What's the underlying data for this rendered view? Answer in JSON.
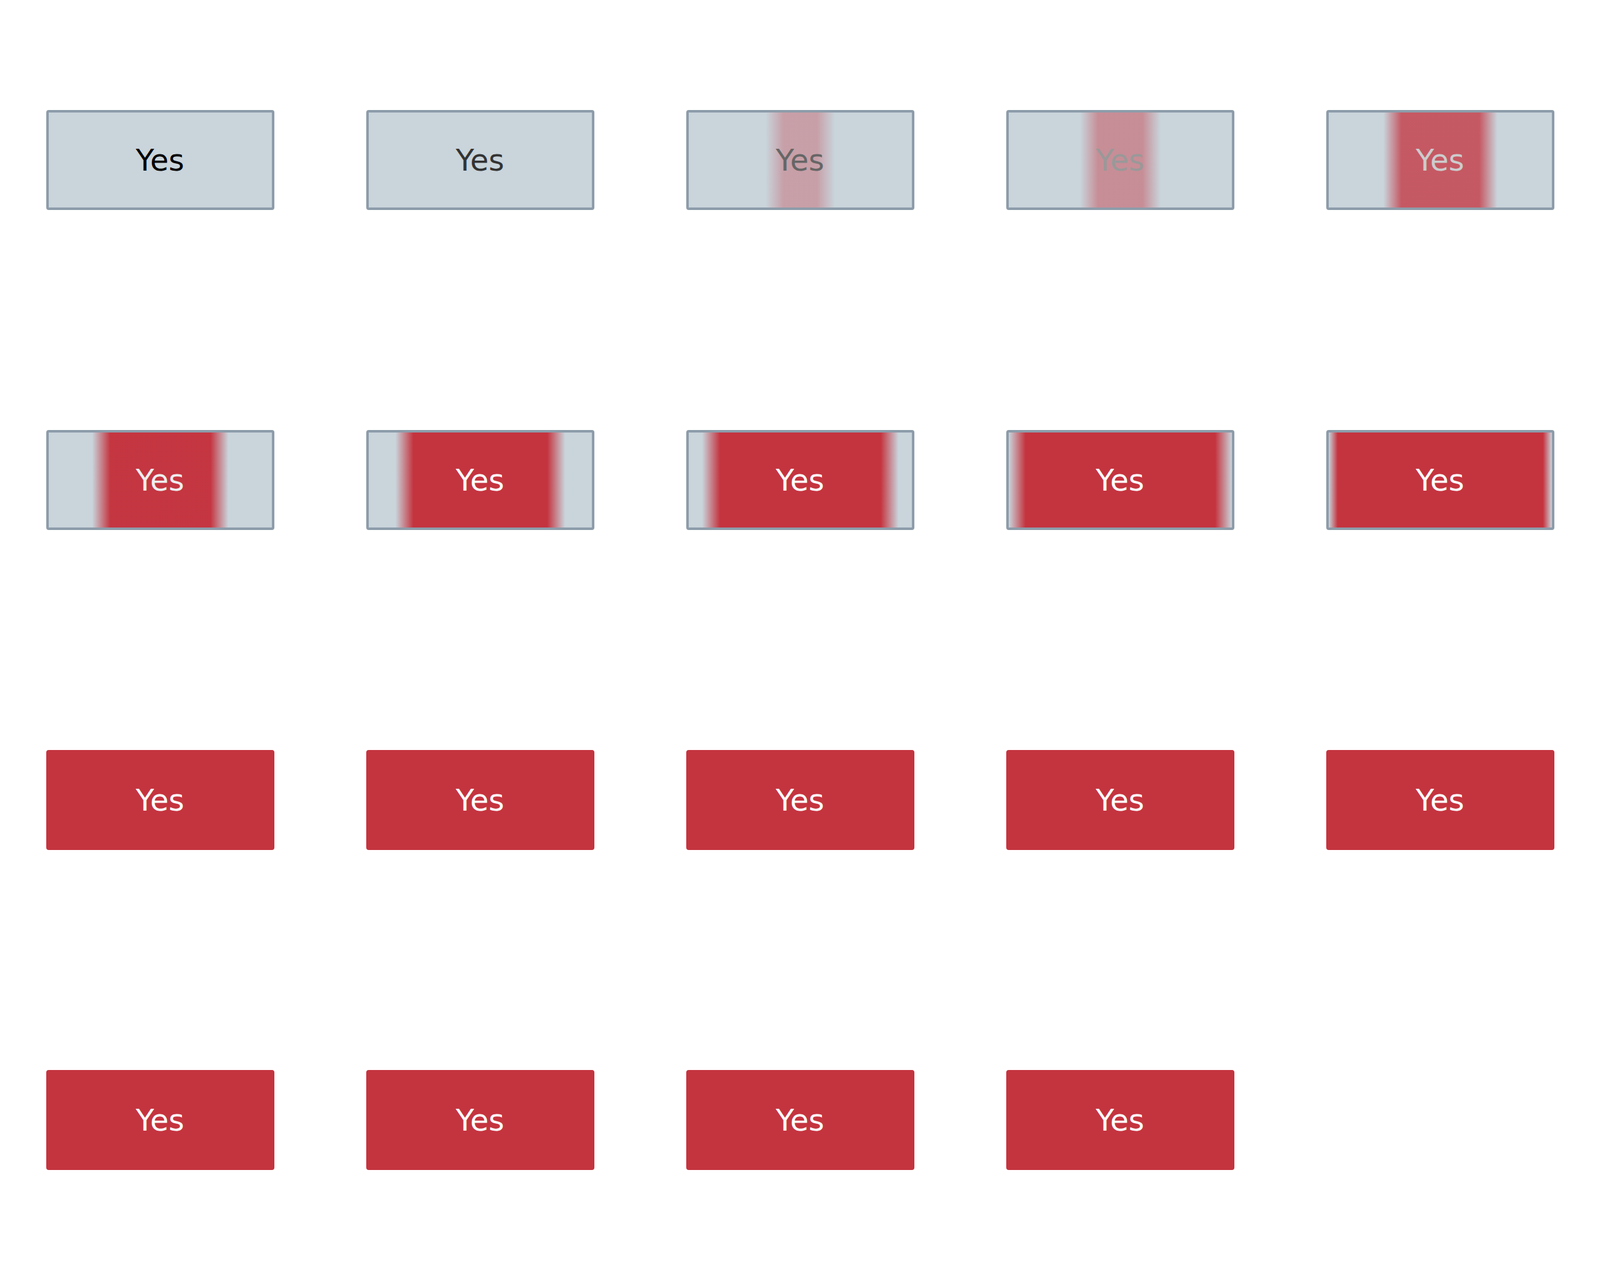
{
  "frames": [
    {
      "label": "Yes",
      "level": 0,
      "color": "#000000"
    },
    {
      "label": "Yes",
      "level": 0,
      "color": "#333333"
    },
    {
      "label": "Yes",
      "level": 0.15,
      "color": "#666666"
    },
    {
      "label": "Yes",
      "level": 0.2,
      "color": "#999999"
    },
    {
      "label": "Yes",
      "level": 0.35,
      "color": "#cccccc"
    },
    {
      "label": "Yes",
      "level": 0.45,
      "color": "#eeeeee"
    },
    {
      "label": "Yes",
      "level": 0.6,
      "color": "#ffffff"
    },
    {
      "label": "Yes",
      "level": 0.72,
      "color": "#ffffff"
    },
    {
      "label": "Yes",
      "level": 0.85,
      "color": "#ffffff"
    },
    {
      "label": "Yes",
      "level": 0.92,
      "color": "#ffffff"
    },
    {
      "label": "Yes",
      "level": 1,
      "color": "#ffffff"
    },
    {
      "label": "Yes",
      "level": 1,
      "color": "#ffffff"
    },
    {
      "label": "Yes",
      "level": 1,
      "color": "#ffffff"
    },
    {
      "label": "Yes",
      "level": 1,
      "color": "#ffffff"
    },
    {
      "label": "Yes",
      "level": 1,
      "color": "#ffffff"
    },
    {
      "label": "Yes",
      "level": 1,
      "color": "#ffffff"
    },
    {
      "label": "Yes",
      "level": 1,
      "color": "#ffffff"
    },
    {
      "label": "Yes",
      "level": 1,
      "color": "#ffffff"
    },
    {
      "label": "Yes",
      "level": 1,
      "color": "#ffffff"
    }
  ]
}
